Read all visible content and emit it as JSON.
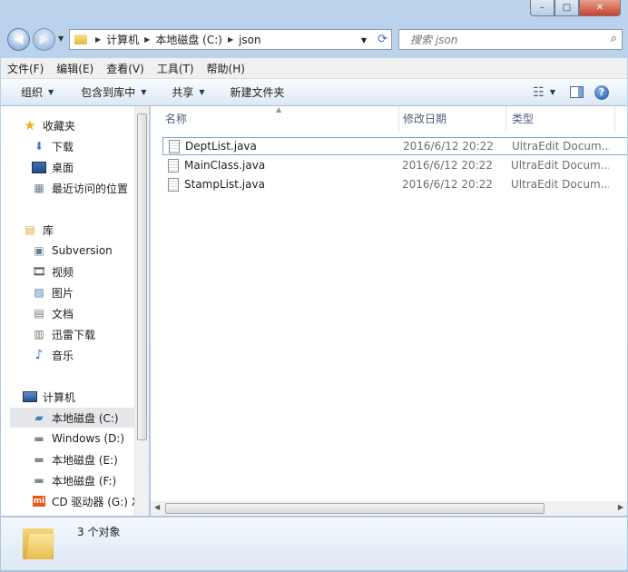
{
  "titlebar": {
    "minimize": "–",
    "maximize": "□",
    "close": "✕"
  },
  "address": {
    "crumbs": [
      "计算机",
      "本地磁盘 (C:)",
      "json"
    ]
  },
  "search": {
    "placeholder": "搜索 json"
  },
  "menu": [
    "文件(F)",
    "编辑(E)",
    "查看(V)",
    "工具(T)",
    "帮助(H)"
  ],
  "toolbar": {
    "organize": "组织",
    "include_in_library": "包含到库中",
    "share": "共享",
    "new_folder": "新建文件夹"
  },
  "nav": {
    "favorites": {
      "label": "收藏夹",
      "items": [
        "下载",
        "桌面",
        "最近访问的位置"
      ]
    },
    "libraries": {
      "label": "库",
      "items": [
        "Subversion",
        "视频",
        "图片",
        "文档",
        "迅雷下载",
        "音乐"
      ]
    },
    "computer": {
      "label": "计算机",
      "items": [
        "本地磁盘 (C:)",
        "Windows (D:)",
        "本地磁盘 (E:)",
        "本地磁盘 (F:)",
        "CD 驱动器 (G:) X"
      ]
    }
  },
  "columns": {
    "name": "名称",
    "date": "修改日期",
    "type": "类型"
  },
  "files": [
    {
      "name": "DeptList.java",
      "date": "2016/6/12 20:22",
      "type": "UltraEdit Docum..."
    },
    {
      "name": "MainClass.java",
      "date": "2016/6/12 20:22",
      "type": "UltraEdit Docum..."
    },
    {
      "name": "StampList.java",
      "date": "2016/6/12 20:22",
      "type": "UltraEdit Docum..."
    }
  ],
  "details": {
    "count": "3 个对象"
  }
}
